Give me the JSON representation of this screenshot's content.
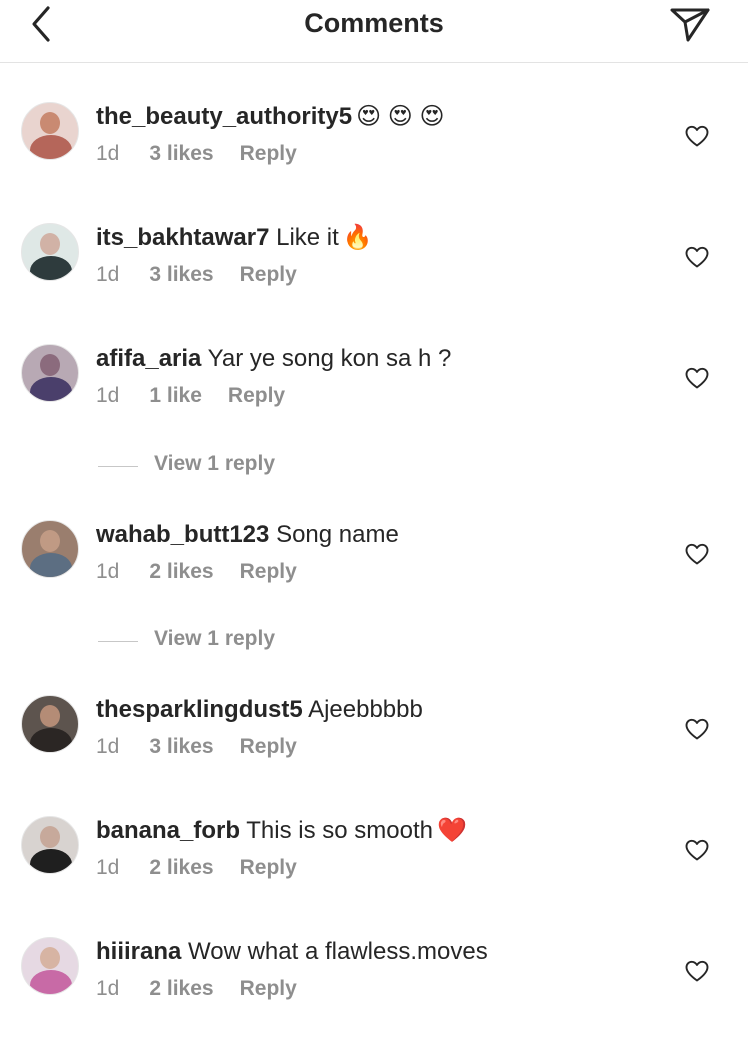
{
  "header": {
    "title": "Comments",
    "back_icon": "chevron-left-icon",
    "send_icon": "paper-plane-icon"
  },
  "comments": [
    {
      "username": "the_beauty_authority5",
      "text": "",
      "emoji": "😍 😍 😍",
      "time": "1d",
      "likes": "3 likes",
      "reply": "Reply",
      "avatar_colors": [
        "#e9d4cf",
        "#c98a72",
        "#b5665a"
      ]
    },
    {
      "username": "its_bakhtawar7",
      "text": "Like it",
      "emoji": "🔥",
      "time": "1d",
      "likes": "3 likes",
      "reply": "Reply",
      "avatar_colors": [
        "#dfe8e6",
        "#d1b2a6",
        "#2e3b3d"
      ]
    },
    {
      "username": "afifa_aria",
      "text": "Yar ye song kon sa h ?",
      "emoji": "",
      "time": "1d",
      "likes": "1 like",
      "reply": "Reply",
      "avatar_colors": [
        "#b8a9b4",
        "#8b6b7d",
        "#4a3f6b"
      ],
      "view_replies": "View 1 reply"
    },
    {
      "username": "wahab_butt123",
      "text": "Song name",
      "emoji": "",
      "time": "1d",
      "likes": "2 likes",
      "reply": "Reply",
      "avatar_colors": [
        "#9a7e6e",
        "#c09a84",
        "#5c6e82"
      ],
      "view_replies": "View 1 reply"
    },
    {
      "username": "thesparklingdust5",
      "text": "Ajeebbbbb",
      "emoji": "",
      "time": "1d",
      "likes": "3 likes",
      "reply": "Reply",
      "avatar_colors": [
        "#5d544e",
        "#b48c76",
        "#2b2624"
      ]
    },
    {
      "username": "banana_forb",
      "text": "This is so smooth",
      "emoji": "❤️",
      "time": "1d",
      "likes": "2 likes",
      "reply": "Reply",
      "avatar_colors": [
        "#d8d3d0",
        "#c7a99b",
        "#1f1f1f"
      ]
    },
    {
      "username": "hiiirana",
      "text": "Wow what a flawless.moves",
      "emoji": "",
      "time": "1d",
      "likes": "2 likes",
      "reply": "Reply",
      "avatar_colors": [
        "#e6d9e3",
        "#d7b4a3",
        "#c86aa6"
      ]
    }
  ],
  "colors": {
    "text_primary": "#262626",
    "text_secondary": "#8e8e8e",
    "divider": "#e3e3e3"
  }
}
